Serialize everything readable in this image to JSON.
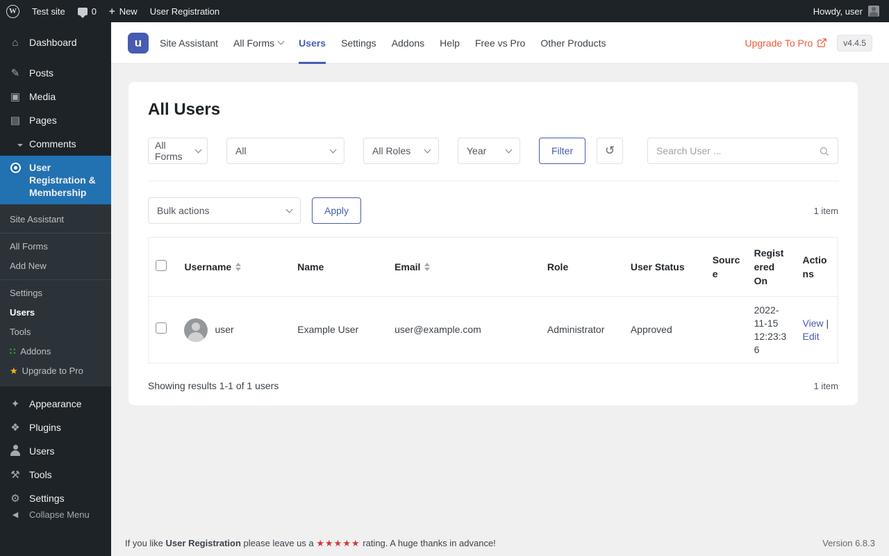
{
  "colors": {
    "accent": "#475bb2",
    "wp_active_blue": "#2271b1",
    "upgrade_orange": "#ee5a3a",
    "status_approved_green": "#43a047",
    "rating_star_red": "#d63638",
    "admin_dark": "#1d2327"
  },
  "admin_bar": {
    "site_name": "Test site",
    "comment_count": "0",
    "new_label": "New",
    "plugin_shortcut": "User Registration",
    "howdy": "Howdy, user"
  },
  "sidebar": {
    "items": [
      {
        "label": "Dashboard"
      },
      {
        "label": "Posts"
      },
      {
        "label": "Media"
      },
      {
        "label": "Pages"
      },
      {
        "label": "Comments"
      }
    ],
    "plugin_item": {
      "label": "User Registration & Membership"
    },
    "submenu": [
      {
        "label": "Site Assistant"
      },
      {
        "label": "All Forms"
      },
      {
        "label": "Add New"
      },
      {
        "label": "Settings"
      },
      {
        "label": "Users"
      },
      {
        "label": "Tools"
      },
      {
        "label": "Addons"
      },
      {
        "label": "Upgrade to Pro"
      }
    ],
    "lower_items": [
      {
        "label": "Appearance"
      },
      {
        "label": "Plugins"
      },
      {
        "label": "Users"
      },
      {
        "label": "Tools"
      },
      {
        "label": "Settings"
      }
    ],
    "collapse_label": "Collapse Menu"
  },
  "top_nav": {
    "items": [
      {
        "label": "Site Assistant"
      },
      {
        "label": "All Forms"
      },
      {
        "label": "Users"
      },
      {
        "label": "Settings"
      },
      {
        "label": "Addons"
      },
      {
        "label": "Help"
      },
      {
        "label": "Free vs Pro"
      },
      {
        "label": "Other Products"
      }
    ],
    "upgrade_label": "Upgrade To Pro",
    "version_badge": "v4.4.5"
  },
  "page": {
    "title": "All Users",
    "filters": {
      "form_filter": "All Forms",
      "status_filter": "All",
      "role_filter": "All Roles",
      "year_filter": "Year",
      "filter_button": "Filter",
      "search_placeholder": "Search User ..."
    },
    "bulk": {
      "action_select": "Bulk actions",
      "apply_button": "Apply"
    },
    "item_count": "1 item",
    "table": {
      "headers": [
        "Username",
        "Name",
        "Email",
        "Role",
        "User Status",
        "Source",
        "Registered On",
        "Actions"
      ],
      "row": {
        "username": "user",
        "name": "Example User",
        "email": "user@example.com",
        "role": "Administrator",
        "status": "Approved",
        "source": "",
        "registered_on": "2022-11-15 12:23:36",
        "view_label": "View",
        "separator": "|",
        "edit_label": "Edit"
      }
    },
    "results_text": "Showing results 1-1 of 1 users"
  },
  "footer": {
    "prefix": "If you like",
    "plugin_name": "User Registration",
    "middle": "please leave us a",
    "stars": "★★★★★",
    "suffix": "rating. A huge thanks in advance!",
    "version": "Version 6.8.3"
  }
}
